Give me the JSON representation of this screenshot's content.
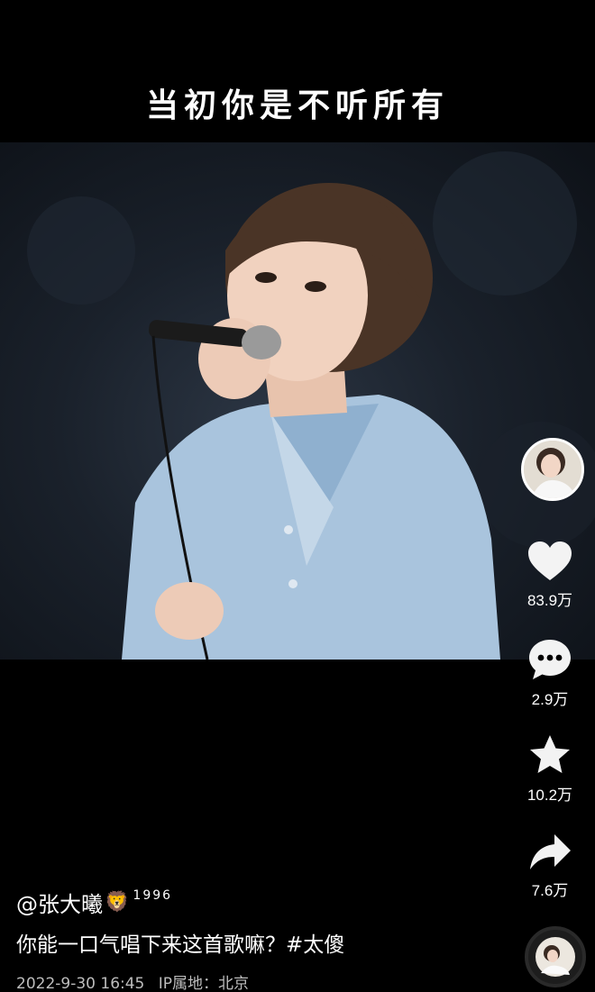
{
  "subtitle": "当初你是不听所有",
  "actions": {
    "likes": "83.9万",
    "comments": "2.9万",
    "favorites": "10.2万",
    "shares": "7.6万"
  },
  "author": {
    "name": "@张大曦",
    "emoji": "🦁",
    "tag": "1996"
  },
  "description": "你能一口气唱下来这首歌嘛？#太傻",
  "meta": {
    "date": "2022-9-30 16:45",
    "ip_location": "IP属地：北京"
  },
  "icons": {
    "like": "heart-icon",
    "comment": "comment-bubble-icon",
    "favorite": "star-icon",
    "share": "share-arrow-icon",
    "music": "music-disc-icon"
  },
  "colors": {
    "background": "#000000",
    "icon": "#ffffff",
    "meta_text": "#bdbdbd"
  }
}
